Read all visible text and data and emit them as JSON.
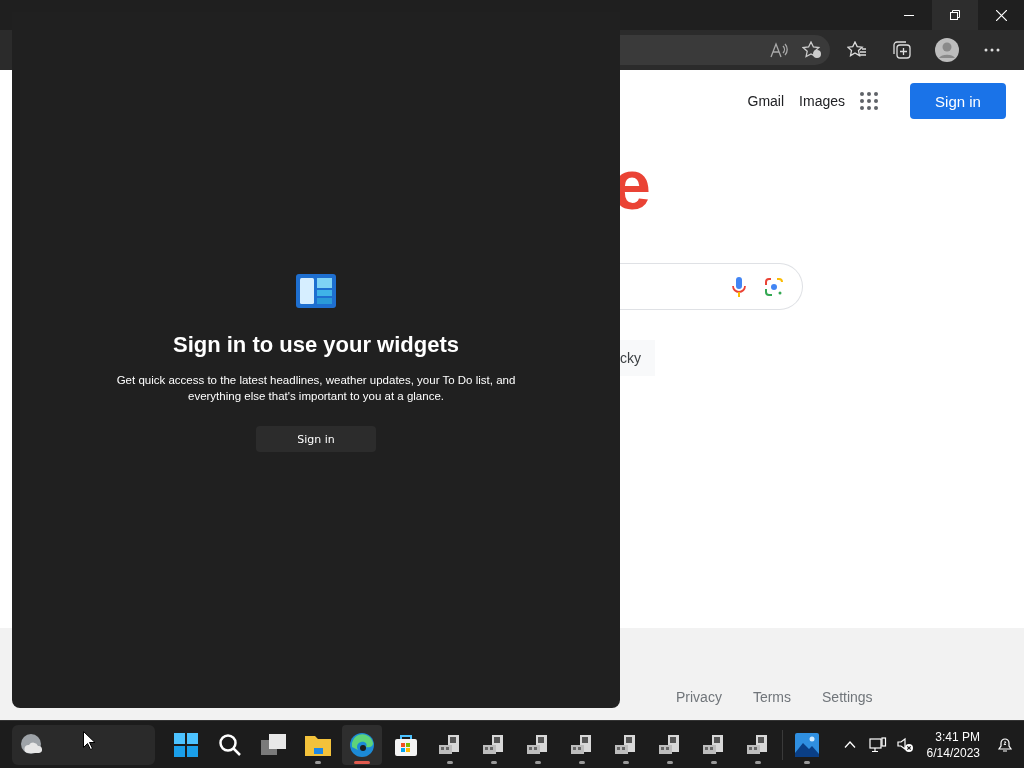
{
  "browser": {
    "header_links": [
      "Gmail",
      "Images"
    ],
    "sign_in": "Sign in",
    "logo_fragment": "e",
    "button_fragment": "cky",
    "footer_links": [
      "Privacy",
      "Terms",
      "Settings"
    ]
  },
  "widgets_panel": {
    "title": "Sign in to use your widgets",
    "description": "Get quick access to the latest headlines, weather updates, your To Do list, and everything else that's important to you at a glance.",
    "button": "Sign in"
  },
  "taskbar": {
    "items": [
      {
        "kind": "start",
        "open": false,
        "active": false
      },
      {
        "kind": "search",
        "open": false,
        "active": false
      },
      {
        "kind": "taskview",
        "open": false,
        "active": false
      },
      {
        "kind": "explorer",
        "open": true,
        "active": false
      },
      {
        "kind": "edge",
        "open": true,
        "active": true
      },
      {
        "kind": "store",
        "open": false,
        "active": false
      },
      {
        "kind": "app",
        "open": true,
        "active": false
      },
      {
        "kind": "app",
        "open": true,
        "active": false
      },
      {
        "kind": "app",
        "open": true,
        "active": false
      },
      {
        "kind": "app",
        "open": true,
        "active": false
      },
      {
        "kind": "app",
        "open": true,
        "active": false
      },
      {
        "kind": "app",
        "open": true,
        "active": false
      },
      {
        "kind": "app",
        "open": true,
        "active": false
      },
      {
        "kind": "app",
        "open": true,
        "active": false
      },
      {
        "kind": "divider"
      },
      {
        "kind": "photos",
        "open": true,
        "active": false
      }
    ],
    "clock": {
      "time": "3:41 PM",
      "date": "6/14/2023"
    }
  }
}
